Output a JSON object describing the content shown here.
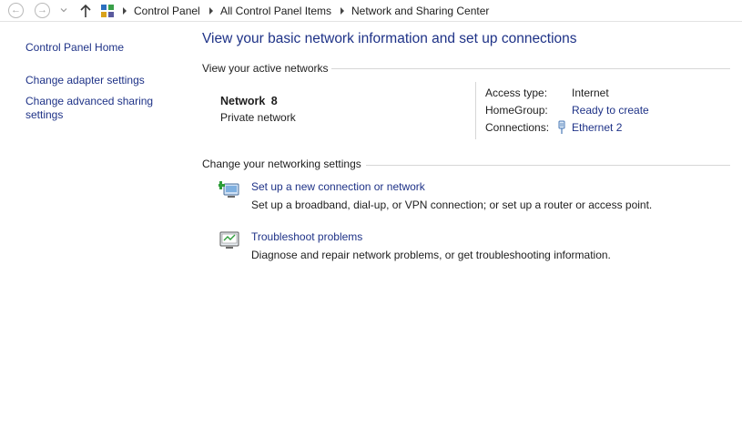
{
  "address_bar": {
    "back_icon": "back-arrow-icon",
    "forward_icon": "forward-arrow-icon",
    "up_icon": "up-arrow-icon",
    "breadcrumbs": [
      "Control Panel",
      "All Control Panel Items",
      "Network and Sharing Center"
    ]
  },
  "sidebar": {
    "home": "Control Panel Home",
    "adapter": "Change adapter settings",
    "sharing_line1": "Change advanced sharing",
    "sharing_line2": "settings"
  },
  "main": {
    "title": "View your basic network information and set up connections",
    "active_networks_heading": "View your active networks",
    "network": {
      "name": "Network 8",
      "type": "Private network",
      "access_type_label": "Access type:",
      "access_type_value": "Internet",
      "homegroup_label": "HomeGroup:",
      "homegroup_value": "Ready to create",
      "connections_label": "Connections:",
      "connections_value": "Ethernet 2"
    },
    "settings_heading": "Change your networking settings",
    "tasks": [
      {
        "link": "Set up a new connection or network",
        "description": "Set up a broadband, dial-up, or VPN connection; or set up a router or access point.",
        "icon": "new-connection-icon"
      },
      {
        "link": "Troubleshoot problems",
        "description": "Diagnose and repair network problems, or get troubleshooting information.",
        "icon": "troubleshoot-icon"
      }
    ]
  },
  "colors": {
    "link": "#1e3287",
    "text": "#1e1e1e",
    "rule": "#d6d6d6"
  }
}
